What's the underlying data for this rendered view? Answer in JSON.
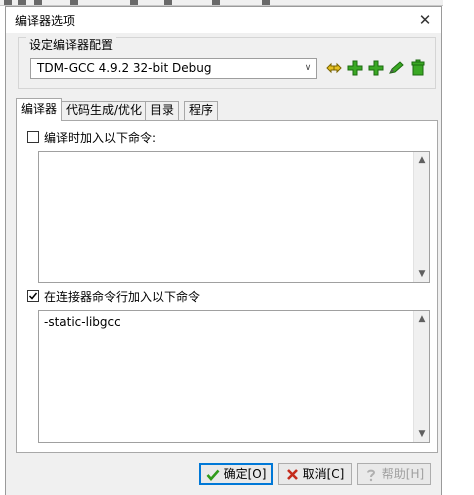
{
  "window": {
    "title": "编译器选项",
    "close_glyph": "✕"
  },
  "config": {
    "group_label": "设定编译器配置",
    "selected_compiler": "TDM-GCC 4.9.2 32-bit Debug",
    "dropdown_glyph": "∨"
  },
  "tabs": [
    {
      "label": "编译器",
      "active": true
    },
    {
      "label": "代码生成/优化",
      "active": false
    },
    {
      "label": "目录",
      "active": false
    },
    {
      "label": "程序",
      "active": false
    }
  ],
  "compile_section": {
    "checkbox_label": "编译时加入以下命令:",
    "checked": false,
    "value": ""
  },
  "linker_section": {
    "checkbox_label": "在连接器命令行加入以下命令",
    "checked": true,
    "value": "-static-libgcc"
  },
  "scroll_glyphs": {
    "up": "▲",
    "down": "▼"
  },
  "buttons": {
    "ok": "确定[O]",
    "cancel": "取消[C]",
    "help": "帮助[H]"
  },
  "colors": {
    "dialog_bg": "#f0f0f0",
    "accent": "#0078d7",
    "tool_green": "#3aa824",
    "ok_check": "#2f9a1a",
    "cancel_x": "#c42b1c"
  }
}
